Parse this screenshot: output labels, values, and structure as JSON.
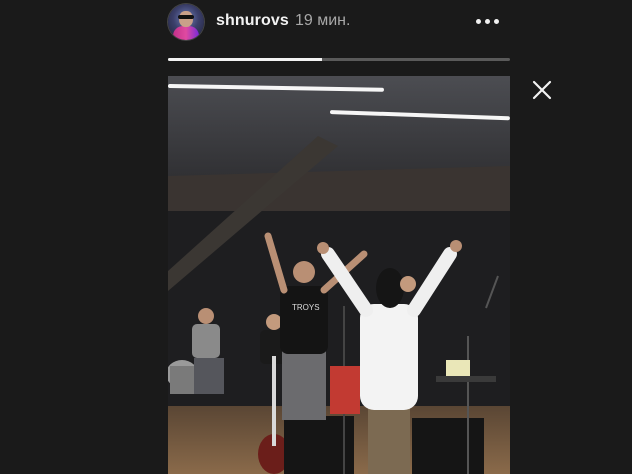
{
  "story": {
    "username": "shnurovs",
    "time_ago": "19 мин.",
    "progress": 0.45,
    "shirt_text": "TROYS"
  },
  "icons": {
    "more": "more-horizontal-icon",
    "close": "close-x-icon"
  },
  "colors": {
    "background": "#1a1a1a",
    "progress_track": "#5a5a5a",
    "progress_fill": "#f3f3f3",
    "text_primary": "#f2f2f2",
    "text_secondary": "#a8a8a8"
  }
}
